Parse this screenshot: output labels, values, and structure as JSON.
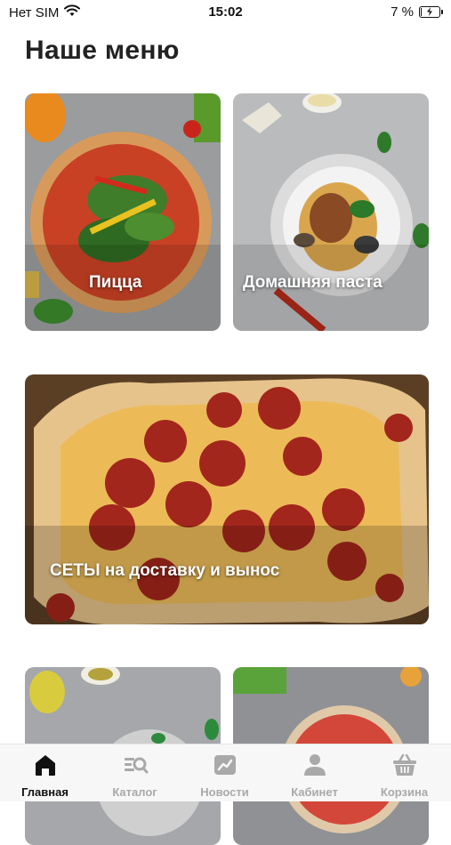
{
  "status_bar": {
    "carrier": "Нет SIM",
    "time": "15:02",
    "battery": "7 %",
    "battery_level": 0.07
  },
  "page": {
    "title": "Наше меню"
  },
  "categories": [
    {
      "label": "Пицца"
    },
    {
      "label": "Домашняя паста"
    },
    {
      "label": "СЕТЫ на доставку и вынос"
    },
    {
      "label": ""
    },
    {
      "label": ""
    }
  ],
  "tabbar": {
    "active_color": "#111111",
    "inactive_color": "#a9a9a9",
    "items": [
      {
        "label": "Главная",
        "icon": "home-icon",
        "active": true
      },
      {
        "label": "Каталог",
        "icon": "catalog-icon",
        "active": false
      },
      {
        "label": "Новости",
        "icon": "news-icon",
        "active": false
      },
      {
        "label": "Кабинет",
        "icon": "user-icon",
        "active": false
      },
      {
        "label": "Корзина",
        "icon": "basket-icon",
        "active": false
      }
    ]
  }
}
